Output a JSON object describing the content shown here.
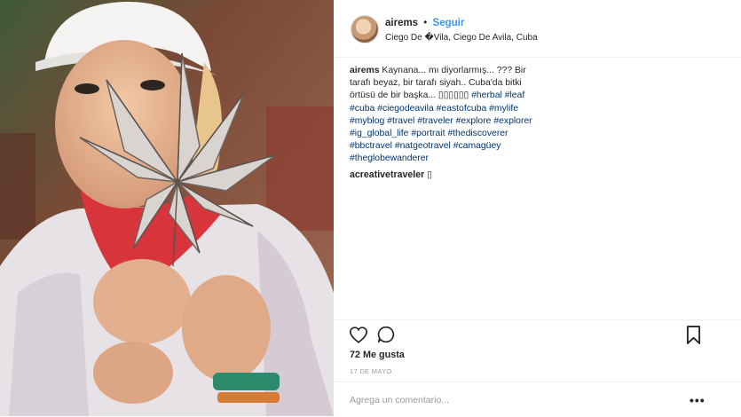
{
  "post": {
    "username": "airems",
    "separator": "•",
    "follow_label": "Seguir",
    "location": "Ciego De �Vila, Ciego De Avila, Cuba"
  },
  "caption": {
    "username": "airems",
    "text": "Kaynana... mı diyorlarmış... ??? Bir tarafı beyaz, bir tarafı siyah.. Cuba'da bitki örtüsü de bir başka... ▯▯▯▯▯▯",
    "hashtags": [
      "#herbal",
      "#leaf",
      "#cuba",
      "#ciegodeavila",
      "#eastofcuba",
      "#mylife",
      "#myblog",
      "#travel",
      "#traveler",
      "#explore",
      "#explorer",
      "#ig_global_life",
      "#portrait",
      "#thediscoverer",
      "#bbctravel",
      "#natgeotravel",
      "#camagüey",
      "#theglobewanderer"
    ]
  },
  "comment": {
    "username": "acreativetraveler",
    "text": "▯"
  },
  "likes_label": "72 Me gusta",
  "date_label": "17 DE MAYO",
  "comment_placeholder": "Agrega un comentario...",
  "more_label": "•••",
  "icons": [
    "heart-icon",
    "comment-icon",
    "bookmark-icon",
    "more-options-icon"
  ]
}
